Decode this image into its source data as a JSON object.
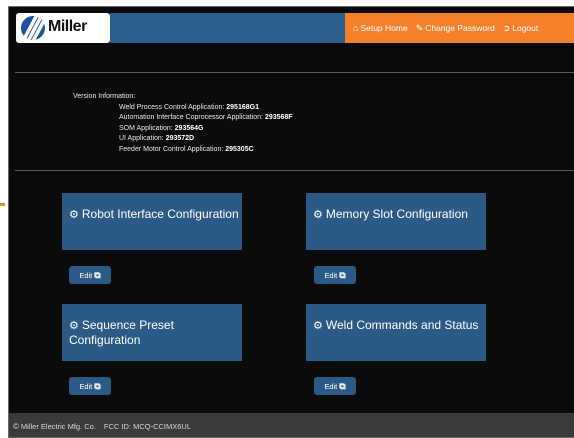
{
  "brand": {
    "logo_text": "Miller"
  },
  "nav": {
    "setup_home": "Setup Home",
    "change_password": "Change Password",
    "logout": "Logout"
  },
  "version": {
    "heading": "Version Information:",
    "rows": [
      {
        "label": "Weld Process Control Application:",
        "value": "295168G1"
      },
      {
        "label": "Automation Interface Coprocessor Application:",
        "value": "293568F"
      },
      {
        "label": "SOM Application:",
        "value": "293564G"
      },
      {
        "label": "UI Application:",
        "value": "293572D"
      },
      {
        "label": "Feeder Motor Control Application:",
        "value": "295305C"
      }
    ]
  },
  "cards": [
    {
      "title": "Robot Interface Configuration",
      "edit_label": "Edit"
    },
    {
      "title": "Memory Slot Configuration",
      "edit_label": "Edit"
    },
    {
      "title": "Sequence Preset Configuration",
      "edit_label": "Edit"
    },
    {
      "title": "Weld Commands and Status",
      "edit_label": "Edit"
    }
  ],
  "footer": {
    "company": "Miller Electric Mfg. Co.",
    "fcc": "FCC ID: MCQ-CCIMX6UL"
  },
  "icons": {
    "home": "home-icon",
    "pencil": "pencil-icon",
    "logout": "logout-icon",
    "gear": "gear-icon",
    "external": "external-link-icon",
    "copyright": "copyright-icon"
  },
  "colors": {
    "nav_bg": "#f4812a",
    "card_bg": "#2a5a85",
    "page_bg": "#0b0b0b",
    "footer_bg": "#3a3a3a"
  }
}
